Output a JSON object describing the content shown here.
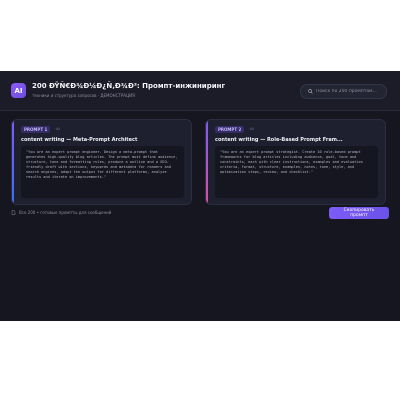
{
  "header": {
    "logo_text": "AI",
    "title": "200 ÐŸÑ€Ð¾Ð¼Ð¿Ñ‚Ð¾Ð²: Промпт-инжиниринг",
    "subtitle": "техники и структура запросов · ДЕМОНСТРАЦИЯ",
    "search_placeholder": "Поиск по 200 промптам..."
  },
  "cards": [
    {
      "badge": "PROMPT 1",
      "meta": "· AI",
      "title": "content writing — Meta-Prompt Architect",
      "body": "\"You are an expert prompt engineer. Design a meta-prompt that generates high-quality blog articles. The prompt must define audience, structure, tone and formatting rules, produce a outline and a SEO-friendly draft with sections, keywords and metadata for readers and search engines, adapt the output for different platforms, analyze results and iterate on improvements.\""
    },
    {
      "badge": "PROMPT 2",
      "meta": "· AI",
      "title": "content writing — Role-Based Prompt Fram...",
      "body": "\"You are an expert prompt strategist. Create 10 role-based prompt frameworks for blog articles including audience, goal, tone and constraints, each with clear instructions, examples and evaluation criteria, format, structure, examples, notes, tone, style, and optimization steps, review, and checklist.\""
    }
  ],
  "footer": {
    "count_text": "Все 200 • готовые промпты для сообщений",
    "cta_label": "Скопировать промпт"
  },
  "colors": {
    "accent": "#7c5cf6",
    "background": "#15161f",
    "card": "#1e2030"
  }
}
